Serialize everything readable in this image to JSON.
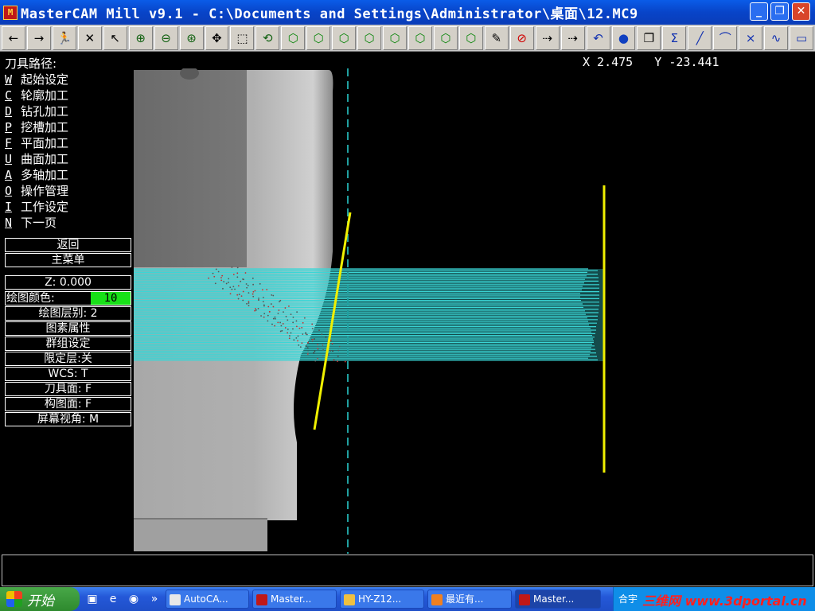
{
  "title": "MasterCAM Mill v9.1 - C:\\Documents and Settings\\Administrator\\桌面\\12.MC9",
  "app_icon": "mastercam-icon",
  "window_buttons": {
    "minimize": "_",
    "maximize": "❐",
    "close": "✕"
  },
  "coords": "X 2.475   Y -23.441",
  "menu": {
    "title": "刀具路径:",
    "items": [
      {
        "key": "W",
        "label": "起始设定"
      },
      {
        "key": "C",
        "label": "轮廓加工"
      },
      {
        "key": "D",
        "label": "钻孔加工"
      },
      {
        "key": "P",
        "label": "挖槽加工"
      },
      {
        "key": "F",
        "label": "平面加工"
      },
      {
        "key": "U",
        "label": "曲面加工"
      },
      {
        "key": "A",
        "label": "多轴加工"
      },
      {
        "key": "O",
        "label": "操作管理"
      },
      {
        "key": "I",
        "label": "工作设定"
      },
      {
        "key": "N",
        "label": "下一页"
      }
    ],
    "back": "返回",
    "main_menu": "主菜单"
  },
  "status": {
    "z": "Z:   0.000",
    "color_label": "绘图颜色:",
    "color_value": "10",
    "level": "绘图层别: 2",
    "attributes": "图素属性",
    "group": "群组设定",
    "mask": "限定层:关",
    "wcs": "WCS:   T",
    "tplane": "刀具面:  F",
    "cplane": "构图面:  F",
    "gview": "屏幕视角:  M"
  },
  "toolbar_icons": [
    "arrow-left-icon",
    "arrow-right-icon",
    "running-man-icon",
    "cross-lines-icon",
    "arrow-help-icon",
    "zoom-in-icon",
    "zoom-out-icon",
    "zoom-8-icon",
    "pan-icon",
    "select-icon",
    "rotate-icon",
    "cube-icon",
    "cube-icon",
    "cube-icon",
    "cube-icon",
    "cube-icon",
    "cube-icon",
    "cube-icon",
    "cube-icon",
    "eraser-icon",
    "no-icon",
    "transform-icon",
    "transform-icon",
    "undo-icon",
    "sphere-icon",
    "copy-icon",
    "sigma-icon",
    "line-icon",
    "arc-icon",
    "trim-icon",
    "spline-icon",
    "rectangle-icon"
  ],
  "taskbar": {
    "start": "开始",
    "tasks": [
      {
        "label": "AutoCA...",
        "active": false
      },
      {
        "label": "Master...",
        "active": false
      },
      {
        "label": "HY-Z12...",
        "active": false
      },
      {
        "label": "最近有...",
        "active": false
      },
      {
        "label": "Master...",
        "active": true
      }
    ],
    "tray": "合宇",
    "watermark": "三维网 www.3dportal.cn"
  },
  "colors": {
    "toolpath": "#3ad6d6",
    "geometry": "#f0f000",
    "axis": "#20a0a0",
    "solid_light": "#b0b0b0",
    "solid_dark": "#6e6e6e",
    "color_swatch": "#18e018"
  }
}
